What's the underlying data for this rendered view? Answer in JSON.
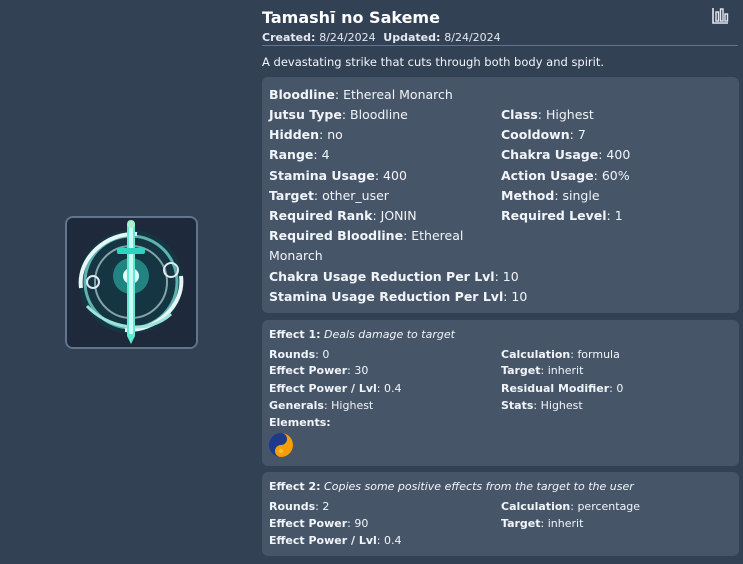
{
  "jutsu": {
    "name": "Tamashī no Sakeme",
    "created_label": "Created:",
    "created": "8/24/2024",
    "updated_label": "Updated:",
    "updated": "8/24/2024",
    "description": "A devastating strike that cuts through both body and spirit.",
    "icon": "sword-emblem-image",
    "chart_icon": "bar-chart-icon"
  },
  "details": {
    "bloodline": [
      "Bloodline",
      "Ethereal Monarch"
    ],
    "jutsu_type": [
      "Jutsu Type",
      "Bloodline"
    ],
    "class": [
      "Class",
      "Highest"
    ],
    "hidden": [
      "Hidden",
      "no"
    ],
    "cooldown": [
      "Cooldown",
      "7"
    ],
    "range": [
      "Range",
      "4"
    ],
    "chakra_usage": [
      "Chakra Usage",
      "400"
    ],
    "stamina_usage": [
      "Stamina Usage",
      "400"
    ],
    "action_usage": [
      "Action Usage",
      "60%"
    ],
    "target": [
      "Target",
      "other_user"
    ],
    "method": [
      "Method",
      "single"
    ],
    "required_rank": [
      "Required Rank",
      "JONIN"
    ],
    "required_level": [
      "Required Level",
      "1"
    ],
    "required_bloodline_label": "Required Bloodline",
    "required_bloodline_line1": "Ethereal",
    "required_bloodline_line2": "Monarch",
    "chakra_reduction": [
      "Chakra Usage Reduction Per Lvl",
      "10"
    ],
    "stamina_reduction": [
      "Stamina Usage Reduction Per Lvl",
      "10"
    ]
  },
  "effect1": {
    "label": "Effect 1:",
    "text": "Deals damage to target",
    "rounds": [
      "Rounds",
      "0"
    ],
    "calculation": [
      "Calculation",
      "formula"
    ],
    "power": [
      "Effect Power",
      "30"
    ],
    "target": [
      "Target",
      "inherit"
    ],
    "power_lvl": [
      "Effect Power / Lvl",
      "0.4"
    ],
    "residual": [
      "Residual Modifier",
      "0"
    ],
    "generals": [
      "Generals",
      "Highest"
    ],
    "stats": [
      "Stats",
      "Highest"
    ],
    "elements_label": "Elements:",
    "element_icon": "yin-yang-element-icon"
  },
  "effect2": {
    "label": "Effect 2:",
    "text": "Copies some positive effects from the target to the user",
    "rounds": [
      "Rounds",
      "2"
    ],
    "calculation": [
      "Calculation",
      "percentage"
    ],
    "power": [
      "Effect Power",
      "90"
    ],
    "target": [
      "Target",
      "inherit"
    ],
    "power_lvl": [
      "Effect Power / Lvl",
      "0.4"
    ]
  },
  "colors": {
    "background": "#334155",
    "card": "#475569",
    "frame": "#64748b"
  }
}
